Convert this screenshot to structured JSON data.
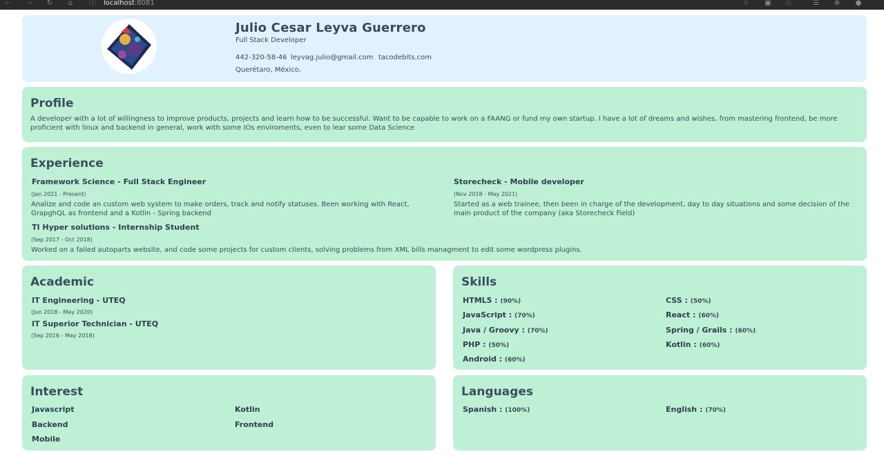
{
  "browser": {
    "url_host": "localhost",
    "url_port": ":8081"
  },
  "header": {
    "name": "Julio Cesar Leyva Guerrero",
    "role": "Full Stack Developer",
    "phone": "442-320-58-46",
    "email": "leyvag.julio@gmail.com",
    "website": "tacodebits.com",
    "location": "Querétaro, México."
  },
  "profile": {
    "title": "Profile",
    "text": "A developer with a lot of willingness to improve products, projects and learn how to be successful. Want to be capable to work on a FAANG or fund my own startup. I have a lot of dreams and wishes, from mastering frontend, be more proficient with linux and backend in general, work with some IOs enviroments, even to lear some Data Science"
  },
  "experience": {
    "title": "Experience",
    "items": [
      {
        "title": "Framework Science - Full Stack Engineer",
        "date": "(Jan 2021 - Present)",
        "description": "Analize and code an custom web system to make orders, track and notify statuses. Been working with React, GrapghQL as frontend and a Kotlin - Spring backend"
      },
      {
        "title": "Storecheck - Mobile developer",
        "date": "(Nov 2018 - May 2021)",
        "description": "Started as a web trainee, then been in charge of the development, day to day situations and some decision of the main product of the company (aka Storecheck Field)"
      },
      {
        "title": "TI Hyper solutions - Internship Student",
        "date": "(Sep 2017 - Oct 2018)",
        "description": "Worked on a failed autoparts website, and code some projects for custom clients, solving problems from XML bills managment to edit some wordpress plugins."
      }
    ]
  },
  "academic": {
    "title": "Academic",
    "items": [
      {
        "title": "IT Engineering - UTEQ",
        "date": "(Jun 2018 - May 2020)"
      },
      {
        "title": "IT Superior Technician - UTEQ",
        "date": "(Sep 2016 - May 2018)"
      }
    ]
  },
  "skills": {
    "title": "Skills",
    "items": [
      {
        "name": "HTML5 :",
        "level": "(90%)"
      },
      {
        "name": "CSS :",
        "level": "(50%)"
      },
      {
        "name": "JavaScript :",
        "level": "(70%)"
      },
      {
        "name": "React :",
        "level": "(60%)"
      },
      {
        "name": "Java / Groovy :",
        "level": "(70%)"
      },
      {
        "name": "Spring / Grails :",
        "level": "(60%)"
      },
      {
        "name": "PHP :",
        "level": "(50%)"
      },
      {
        "name": "Kotlin :",
        "level": "(60%)"
      },
      {
        "name": "Android :",
        "level": "(60%)"
      }
    ]
  },
  "interest": {
    "title": "Interest",
    "items": [
      "Javascript",
      "Kotlin",
      "Backend",
      "Frontend",
      "Mobile"
    ]
  },
  "languages": {
    "title": "Languages",
    "items": [
      {
        "name": "Spanish :",
        "level": "(100%)"
      },
      {
        "name": "English :",
        "level": "(70%)"
      }
    ]
  },
  "colors": {
    "header_bg": "#dff2fd",
    "card_bg": "#bdf0d4",
    "text": "#3b4a5a"
  }
}
